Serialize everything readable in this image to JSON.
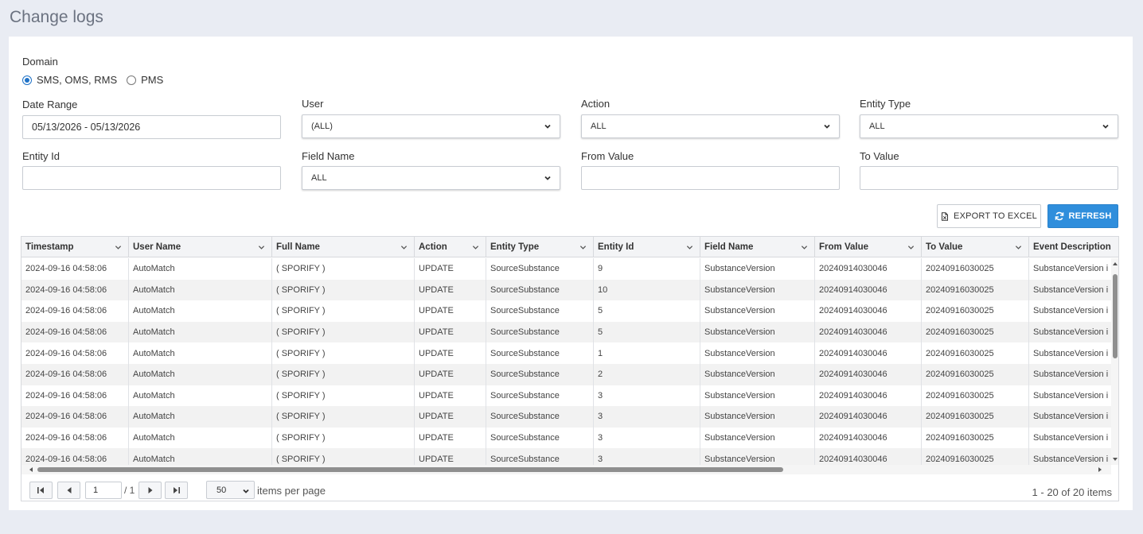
{
  "page": {
    "title": "Change logs"
  },
  "filters": {
    "domain": {
      "label": "Domain",
      "options": [
        {
          "label": "SMS, OMS, RMS",
          "checked": true
        },
        {
          "label": "PMS",
          "checked": false
        }
      ]
    },
    "date_range": {
      "label": "Date Range",
      "value": "05/13/2026 - 05/13/2026"
    },
    "user": {
      "label": "User",
      "value": "(ALL)"
    },
    "action": {
      "label": "Action",
      "value": "ALL"
    },
    "entity_type": {
      "label": "Entity Type",
      "value": "ALL"
    },
    "entity_id": {
      "label": "Entity Id",
      "value": ""
    },
    "field_name": {
      "label": "Field Name",
      "value": "ALL"
    },
    "from_value": {
      "label": "From Value",
      "value": ""
    },
    "to_value": {
      "label": "To Value",
      "value": ""
    }
  },
  "toolbar": {
    "export_label": "EXPORT TO EXCEL",
    "refresh_label": "REFRESH"
  },
  "grid": {
    "columns": [
      "Timestamp",
      "User Name",
      "Full Name",
      "Action",
      "Entity Type",
      "Entity Id",
      "Field Name",
      "From Value",
      "To Value",
      "Event Description"
    ],
    "rows": [
      [
        "2024-09-16 04:58:06",
        "AutoMatch",
        "( SPORIFY )",
        "UPDATE",
        "SourceSubstance",
        "9",
        "SubstanceVersion",
        "20240914030046",
        "20240916030025",
        "SubstanceVersion i"
      ],
      [
        "2024-09-16 04:58:06",
        "AutoMatch",
        "( SPORIFY )",
        "UPDATE",
        "SourceSubstance",
        "10",
        "SubstanceVersion",
        "20240914030046",
        "20240916030025",
        "SubstanceVersion i"
      ],
      [
        "2024-09-16 04:58:06",
        "AutoMatch",
        "( SPORIFY )",
        "UPDATE",
        "SourceSubstance",
        "5",
        "SubstanceVersion",
        "20240914030046",
        "20240916030025",
        "SubstanceVersion i"
      ],
      [
        "2024-09-16 04:58:06",
        "AutoMatch",
        "( SPORIFY )",
        "UPDATE",
        "SourceSubstance",
        "5",
        "SubstanceVersion",
        "20240914030046",
        "20240916030025",
        "SubstanceVersion i"
      ],
      [
        "2024-09-16 04:58:06",
        "AutoMatch",
        "( SPORIFY )",
        "UPDATE",
        "SourceSubstance",
        "1",
        "SubstanceVersion",
        "20240914030046",
        "20240916030025",
        "SubstanceVersion i"
      ],
      [
        "2024-09-16 04:58:06",
        "AutoMatch",
        "( SPORIFY )",
        "UPDATE",
        "SourceSubstance",
        "2",
        "SubstanceVersion",
        "20240914030046",
        "20240916030025",
        "SubstanceVersion i"
      ],
      [
        "2024-09-16 04:58:06",
        "AutoMatch",
        "( SPORIFY )",
        "UPDATE",
        "SourceSubstance",
        "3",
        "SubstanceVersion",
        "20240914030046",
        "20240916030025",
        "SubstanceVersion i"
      ],
      [
        "2024-09-16 04:58:06",
        "AutoMatch",
        "( SPORIFY )",
        "UPDATE",
        "SourceSubstance",
        "3",
        "SubstanceVersion",
        "20240914030046",
        "20240916030025",
        "SubstanceVersion i"
      ],
      [
        "2024-09-16 04:58:06",
        "AutoMatch",
        "( SPORIFY )",
        "UPDATE",
        "SourceSubstance",
        "3",
        "SubstanceVersion",
        "20240914030046",
        "20240916030025",
        "SubstanceVersion i"
      ],
      [
        "2024-09-16 04:58:06",
        "AutoMatch",
        "( SPORIFY )",
        "UPDATE",
        "SourceSubstance",
        "3",
        "SubstanceVersion",
        "20240914030046",
        "20240916030025",
        "SubstanceVersion i"
      ]
    ]
  },
  "pager": {
    "page": "1",
    "of_label": "/ 1",
    "page_size": "50",
    "per_page_label": "items per page",
    "info": "1 - 20 of 20 items"
  },
  "colors": {
    "accent": "#2f8edc",
    "radio": "#1f72c7"
  }
}
